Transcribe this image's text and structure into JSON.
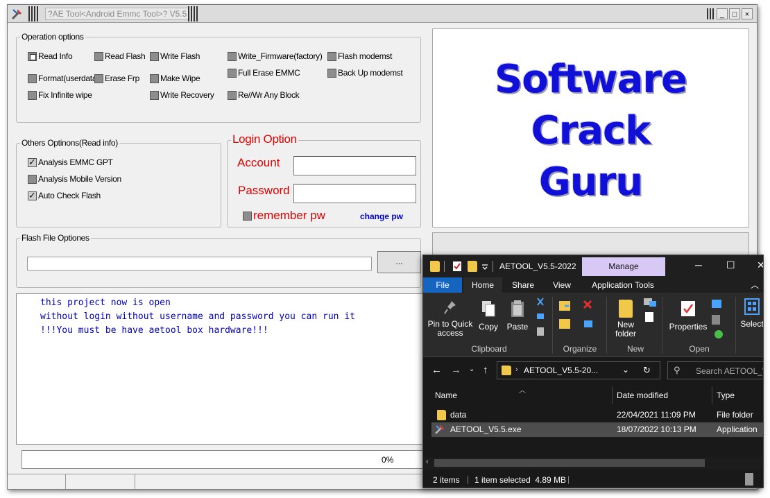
{
  "window": {
    "title": "?AE Tool<Android Emmc Tool>? V5.5",
    "controls": [
      "_",
      "□",
      "×"
    ]
  },
  "operation_options": {
    "label": "Operation options",
    "items": [
      {
        "label": "Read Info",
        "state": "selected"
      },
      {
        "label": "Read Flash",
        "state": "off"
      },
      {
        "label": "Write Flash",
        "state": "off"
      },
      {
        "label": "Write_Firmware(factory)",
        "state": "off"
      },
      {
        "label": "Flash modemst",
        "state": "off"
      },
      {
        "label": "Format(userdata)",
        "state": "off"
      },
      {
        "label": "Erase Frp",
        "state": "off"
      },
      {
        "label": "Make Wipe",
        "state": "off"
      },
      {
        "label": "Full Erase EMMC",
        "state": "off"
      },
      {
        "label": "Back Up modemst",
        "state": "off"
      },
      {
        "label": "Fix Infinite wipe",
        "state": "off"
      },
      {
        "label": "Write Recovery",
        "state": "off"
      },
      {
        "label": "Re//Wr Any Block",
        "state": "off"
      }
    ]
  },
  "others_options": {
    "label": "Others Optinons(Read info)",
    "items": [
      {
        "label": "Analysis EMMC GPT",
        "checked": true
      },
      {
        "label": "Analysis Mobile Version",
        "checked": false
      },
      {
        "label": "Auto Check Flash",
        "checked": true
      }
    ]
  },
  "login": {
    "label": "Login Option",
    "account_label": "Account",
    "password_label": "Password",
    "account_value": "",
    "password_value": "",
    "remember_label": "remember pw",
    "change_pw_label": "change pw"
  },
  "flash_file": {
    "label": "Flash File Optiones",
    "path_value": "",
    "browse_label": "..."
  },
  "logo": {
    "lines": [
      "Software",
      "Crack",
      "Guru"
    ]
  },
  "log": {
    "lines": [
      "this project now is open",
      "without login without username and password you can run it",
      "!!!You must be have aetool box hardware!!!"
    ]
  },
  "progress": {
    "text": "0%",
    "value": 0
  },
  "explorer": {
    "title": "AETOOL_V5.5-2022",
    "manage_label": "Manage",
    "tabs": [
      "File",
      "Home",
      "Share",
      "View",
      "Application Tools"
    ],
    "ribbon": {
      "pin_label": "Pin to Quick access",
      "copy_label": "Copy",
      "paste_label": "Paste",
      "clipboard_group": "Clipboard",
      "organize_group": "Organize",
      "new_folder_label": "New folder",
      "new_group": "New",
      "properties_label": "Properties",
      "open_group": "Open",
      "select_label": "Select"
    },
    "address": "AETOOL_V5.5-20...",
    "search_placeholder": "Search AETOOL_V...",
    "columns": [
      "Name",
      "Date modified",
      "Type"
    ],
    "files": [
      {
        "name": "data",
        "date": "22/04/2021 11:09 PM",
        "type": "File folder",
        "selected": false
      },
      {
        "name": "AETOOL_V5.5.exe",
        "date": "18/07/2022 10:13 PM",
        "type": "Application",
        "selected": true
      }
    ],
    "status": {
      "items": "2 items",
      "selected": "1 item selected  4.89 MB"
    }
  }
}
